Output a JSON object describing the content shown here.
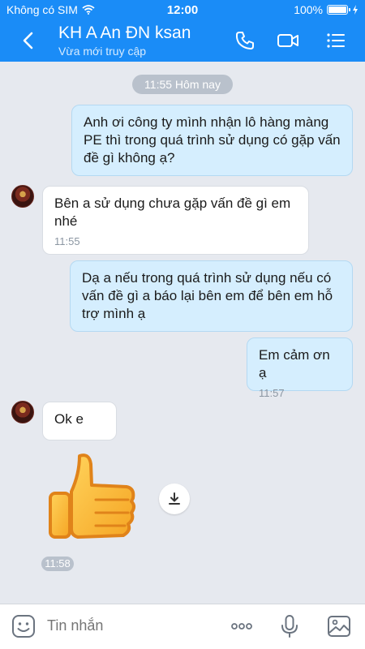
{
  "status_bar": {
    "carrier": "Không có SIM",
    "time": "12:00",
    "battery": "100%",
    "battery_level": 1.0
  },
  "header": {
    "title": "KH A An ĐN ksan",
    "subtitle": "Vừa mới truy cập"
  },
  "chat": {
    "date_chip": "11:55 Hôm nay",
    "messages": [
      {
        "from": "me",
        "text": "Anh ơi công ty mình nhận lô hàng màng PE thì trong quá trình sử dụng có gặp vấn đề gì không ạ?"
      },
      {
        "from": "them",
        "text": "Bên a sử dụng chưa gặp vấn đề gì em nhé",
        "time": "11:55"
      },
      {
        "from": "me",
        "text": "Dạ a nếu trong quá trình sử dụng nếu có vấn đề gì a báo lại bên em để bên em hỗ trợ mình ạ"
      },
      {
        "from": "me",
        "text": "Em cảm ơn ạ",
        "time": "11:57"
      },
      {
        "from": "them",
        "text": "Ok e"
      }
    ],
    "sticker_time": "11:58",
    "sticker_icon": "thumbs-up-sticker"
  },
  "input": {
    "placeholder": "Tin nhắn"
  },
  "colors": {
    "header_bg": "#1a8cf7",
    "my_bubble": "#d5eefe",
    "their_bubble": "#ffffff",
    "chat_bg": "#e6e9ef"
  },
  "icons": [
    "wifi-icon",
    "back-icon",
    "phone-icon",
    "video-call-icon",
    "menu-icon",
    "download-icon",
    "sticker-icon",
    "more-icon",
    "mic-icon",
    "photo-icon",
    "charging-icon"
  ]
}
